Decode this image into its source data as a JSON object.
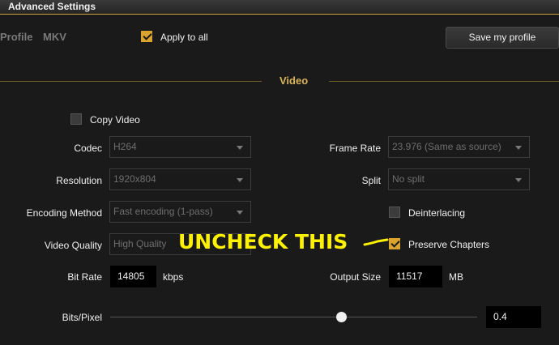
{
  "window": {
    "title": "Advanced Settings"
  },
  "profile": {
    "label": "Profile",
    "name": "MKV"
  },
  "apply_all": {
    "label": "Apply to all",
    "checked": true
  },
  "save_button": {
    "label": "Save my profile"
  },
  "section": {
    "title": "Video"
  },
  "copy_video": {
    "label": "Copy Video",
    "checked": false
  },
  "codec": {
    "label": "Codec",
    "value": "H264"
  },
  "resolution": {
    "label": "Resolution",
    "value": "1920x804"
  },
  "encoding_method": {
    "label": "Encoding Method",
    "value": "Fast encoding (1-pass)"
  },
  "video_quality": {
    "label": "Video Quality",
    "value": "High Quality"
  },
  "bit_rate": {
    "label": "Bit Rate",
    "value": "14805",
    "unit": "kbps"
  },
  "frame_rate": {
    "label": "Frame Rate",
    "value": "23.976 (Same as source)"
  },
  "split": {
    "label": "Split",
    "value": "No split"
  },
  "deinterlacing": {
    "label": "Deinterlacing",
    "checked": false
  },
  "preserve_chapters": {
    "label": "Preserve Chapters",
    "checked": true
  },
  "output_size": {
    "label": "Output Size",
    "value": "11517",
    "unit": "MB"
  },
  "bits_pixel": {
    "label": "Bits/Pixel",
    "value": "0.4",
    "slider_fraction": 0.63
  },
  "annotation": {
    "text": "UNCHECK THIS",
    "color": "#fff200"
  },
  "colors": {
    "accent": "#d9a32e",
    "background": "#1a1a1a",
    "section_title": "#d9b45a"
  }
}
